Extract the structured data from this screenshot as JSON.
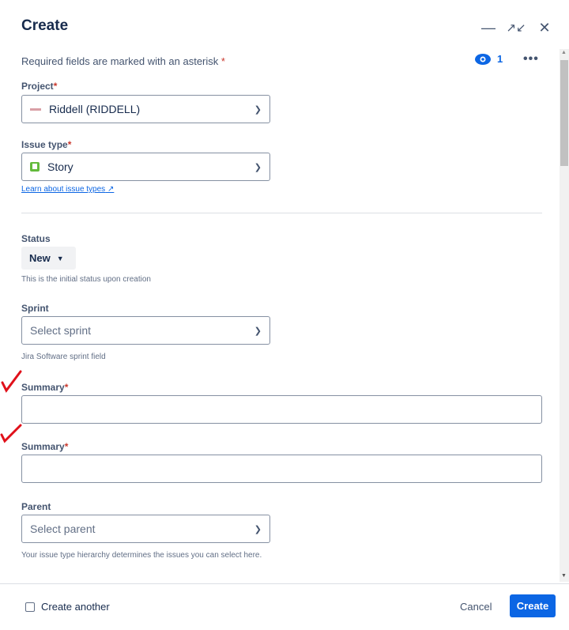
{
  "title": "Create",
  "required_note": "Required fields are marked with an asterisk",
  "asterisk": "*",
  "watchers": "1",
  "project": {
    "label": "Project",
    "value": "Riddell (RIDDELL)"
  },
  "issue_type": {
    "label": "Issue type",
    "value": "Story",
    "link": "Learn about issue types"
  },
  "status": {
    "label": "Status",
    "value": "New",
    "help": "This is the initial status upon creation"
  },
  "sprint": {
    "label": "Sprint",
    "placeholder": "Select sprint",
    "help": "Jira Software sprint field"
  },
  "summary1": {
    "label": "Summary"
  },
  "summary2": {
    "label": "Summary"
  },
  "parent": {
    "label": "Parent",
    "placeholder": "Select parent",
    "help": "Your issue type hierarchy determines the issues you can select here."
  },
  "footer": {
    "create_another": "Create another",
    "cancel": "Cancel",
    "create": "Create"
  },
  "colors": {
    "primary": "#0c66e4",
    "required": "#c9372c",
    "annotation": "#e0101a"
  }
}
